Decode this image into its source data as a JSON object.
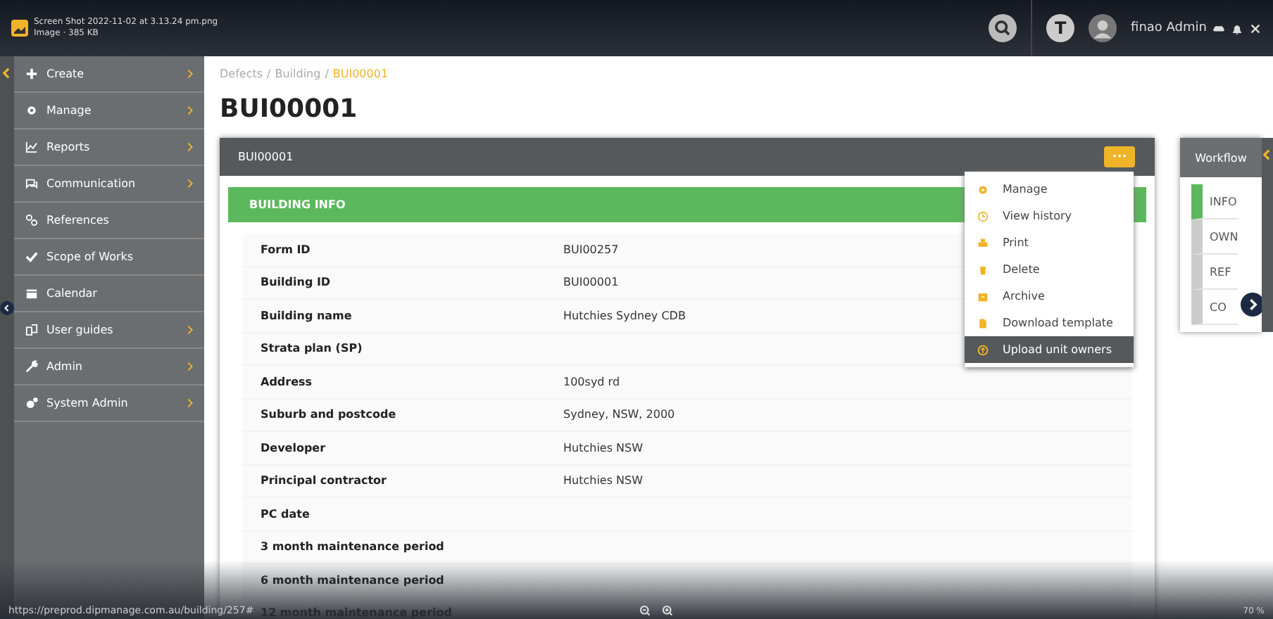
{
  "viewer": {
    "file_name": "Screen Shot 2022-11-02 at 3.13.24 pm.png",
    "file_info": "Image · 385 KB",
    "link": "https://preprod.dipmanage.com.au/building/257#",
    "zoom": "70 %"
  },
  "topbar": {
    "user_initial": "T",
    "user_name": "finao Admin"
  },
  "sidebar": {
    "items": [
      {
        "label": "Create",
        "has_arrow": true
      },
      {
        "label": "Manage",
        "has_arrow": true
      },
      {
        "label": "Reports",
        "has_arrow": true
      },
      {
        "label": "Communication",
        "has_arrow": true
      },
      {
        "label": "References",
        "has_arrow": false
      },
      {
        "label": "Scope of Works",
        "has_arrow": false
      },
      {
        "label": "Calendar",
        "has_arrow": false
      },
      {
        "label": "User guides",
        "has_arrow": true
      },
      {
        "label": "Admin",
        "has_arrow": true
      },
      {
        "label": "System Admin",
        "has_arrow": true
      }
    ]
  },
  "breadcrumb": {
    "separator": "/",
    "items": [
      {
        "label": "Defects",
        "current": false
      },
      {
        "label": "Building",
        "current": false
      },
      {
        "label": "BUI00001",
        "current": true
      }
    ]
  },
  "page_title": "BUI00001",
  "panel": {
    "title": "BUI00001",
    "more_label": "•••",
    "section": "BUILDING INFO",
    "fields": [
      {
        "label": "Form ID",
        "value": "BUI00257"
      },
      {
        "label": "Building ID",
        "value": "BUI00001"
      },
      {
        "label": "Building name",
        "value": "Hutchies Sydney CDB"
      },
      {
        "label": "Strata plan (SP)"
      },
      {
        "label": "Address",
        "value": "100syd rd"
      },
      {
        "label": "Suburb and postcode",
        "value": "Sydney, NSW, 2000"
      },
      {
        "label": "Developer",
        "value": "Hutchies NSW"
      },
      {
        "label": "Principal contractor",
        "value": "Hutchies NSW"
      },
      {
        "label": "PC date"
      },
      {
        "label": "3 month maintenance period"
      },
      {
        "label": "6 month maintenance period"
      },
      {
        "label": "12 month maintenance period"
      }
    ]
  },
  "menu": {
    "items": [
      {
        "label": "Manage",
        "selected": false
      },
      {
        "label": "View history",
        "selected": false
      },
      {
        "label": "Print",
        "selected": false
      },
      {
        "label": "Delete",
        "selected": false
      },
      {
        "label": "Archive",
        "selected": false
      },
      {
        "label": "Download template",
        "selected": false
      },
      {
        "label": "Upload unit owners",
        "selected": true
      }
    ]
  },
  "workflow": {
    "title": "Workflow",
    "steps": [
      {
        "label": "INFO",
        "selected": true
      },
      {
        "label": "OWN",
        "selected": false
      },
      {
        "label": "REF",
        "selected": false
      },
      {
        "label": "CO",
        "selected": false
      }
    ]
  }
}
